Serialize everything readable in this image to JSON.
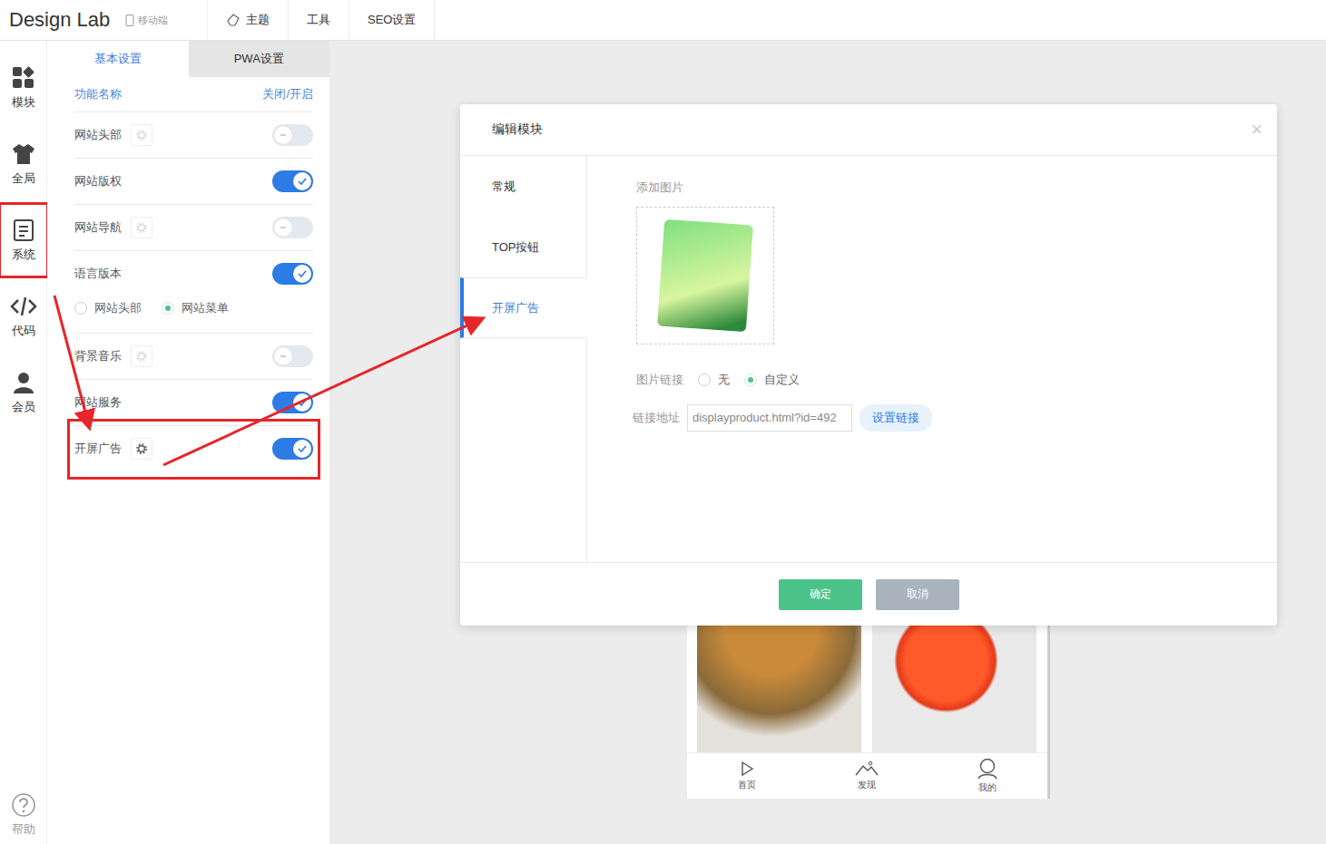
{
  "topbar": {
    "logo": "Design Lab",
    "device": "移动端",
    "nav": [
      {
        "label": "主题",
        "icon": true
      },
      {
        "label": "工具",
        "icon": false
      },
      {
        "label": "SEO设置",
        "icon": false
      }
    ]
  },
  "rail": [
    {
      "label": "模块",
      "selected": false,
      "highlighted": false
    },
    {
      "label": "全局",
      "selected": false,
      "highlighted": false
    },
    {
      "label": "系统",
      "selected": true,
      "highlighted": true
    },
    {
      "label": "代码",
      "selected": false,
      "highlighted": false
    },
    {
      "label": "会员",
      "selected": false,
      "highlighted": false
    }
  ],
  "help": "帮助",
  "panel": {
    "tabs": [
      {
        "label": "基本设置",
        "selected": true
      },
      {
        "label": "PWA设置",
        "selected": false
      }
    ],
    "columns": [
      "功能名称",
      "关闭/开启"
    ],
    "features": [
      {
        "name": "网站头部",
        "settings": true,
        "on": false,
        "highlighted": false
      },
      {
        "name": "网站版权",
        "settings": false,
        "on": true,
        "highlighted": false
      },
      {
        "name": "网站导航",
        "settings": true,
        "on": false,
        "highlighted": false
      },
      {
        "name": "语言版本",
        "settings": false,
        "on": true,
        "highlighted": false,
        "options": [
          {
            "label": "网站头部",
            "selected": false
          },
          {
            "label": "网站菜单",
            "selected": true
          }
        ]
      },
      {
        "name": "背景音乐",
        "settings": true,
        "on": false,
        "highlighted": false
      },
      {
        "name": "网站服务",
        "settings": false,
        "on": true,
        "highlighted": false
      },
      {
        "name": "开屏广告",
        "settings": true,
        "on": true,
        "highlighted": true
      }
    ]
  },
  "modal": {
    "title": "编辑模块",
    "close": "×",
    "tabs": [
      {
        "label": "常规",
        "selected": false
      },
      {
        "label": "TOP按钮",
        "selected": false
      },
      {
        "label": "开屏广告",
        "selected": true
      }
    ],
    "image_label": "添加图片",
    "link_label": "图片链接",
    "link_options": [
      {
        "label": "无",
        "selected": false
      },
      {
        "label": "自定义",
        "selected": true
      }
    ],
    "address_label": "链接地址",
    "address": "displayproduct.html?id=492",
    "set_link": "设置链接",
    "buttons": [
      {
        "label": "确定",
        "kind": "primary"
      },
      {
        "label": "取消",
        "kind": "secondary"
      }
    ]
  },
  "preview": {
    "nav": [
      {
        "label": "首页"
      },
      {
        "label": "发现"
      },
      {
        "label": "我的"
      }
    ]
  }
}
